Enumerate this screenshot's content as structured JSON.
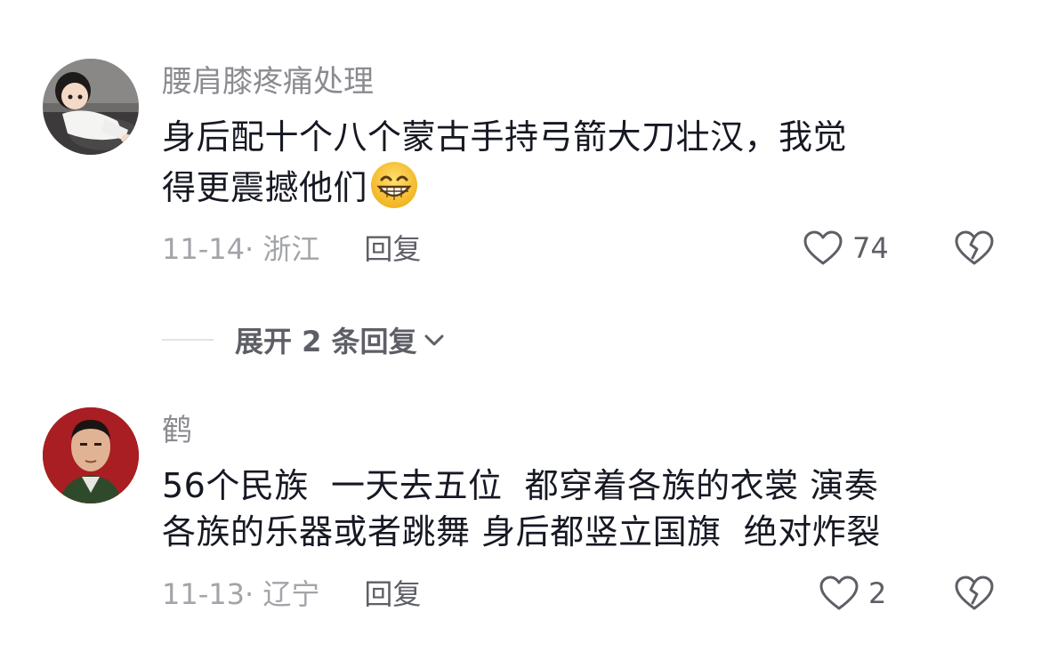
{
  "comments": [
    {
      "username": "腰肩膝疼痛处理",
      "avatar_icon": "cartoon-child-avatar",
      "content_lines": [
        "身后配十个八个蒙古手持弓箭大刀壮汉，我觉",
        "得更震撼他们"
      ],
      "emoji_icon": "grinning-emoji-icon",
      "date_location": "11-14· 浙江",
      "reply_label": "回复",
      "like_count": "74"
    },
    {
      "username": "鹤",
      "avatar_icon": "portrait-photo-avatar",
      "content_lines": [
        "56个民族  一天去五位  都穿着各族的衣裳 演奏",
        "各族的乐器或者跳舞 身后都竖立国旗  绝对炸裂"
      ],
      "date_location": "11-13· 辽宁",
      "reply_label": "回复",
      "like_count": "2"
    }
  ],
  "expand_replies": {
    "label": "展开 2 条回复"
  },
  "colors": {
    "text_primary": "#161823",
    "text_secondary": "#8a8b91",
    "text_meta": "#a3a4a9",
    "action": "#5e5f66"
  }
}
